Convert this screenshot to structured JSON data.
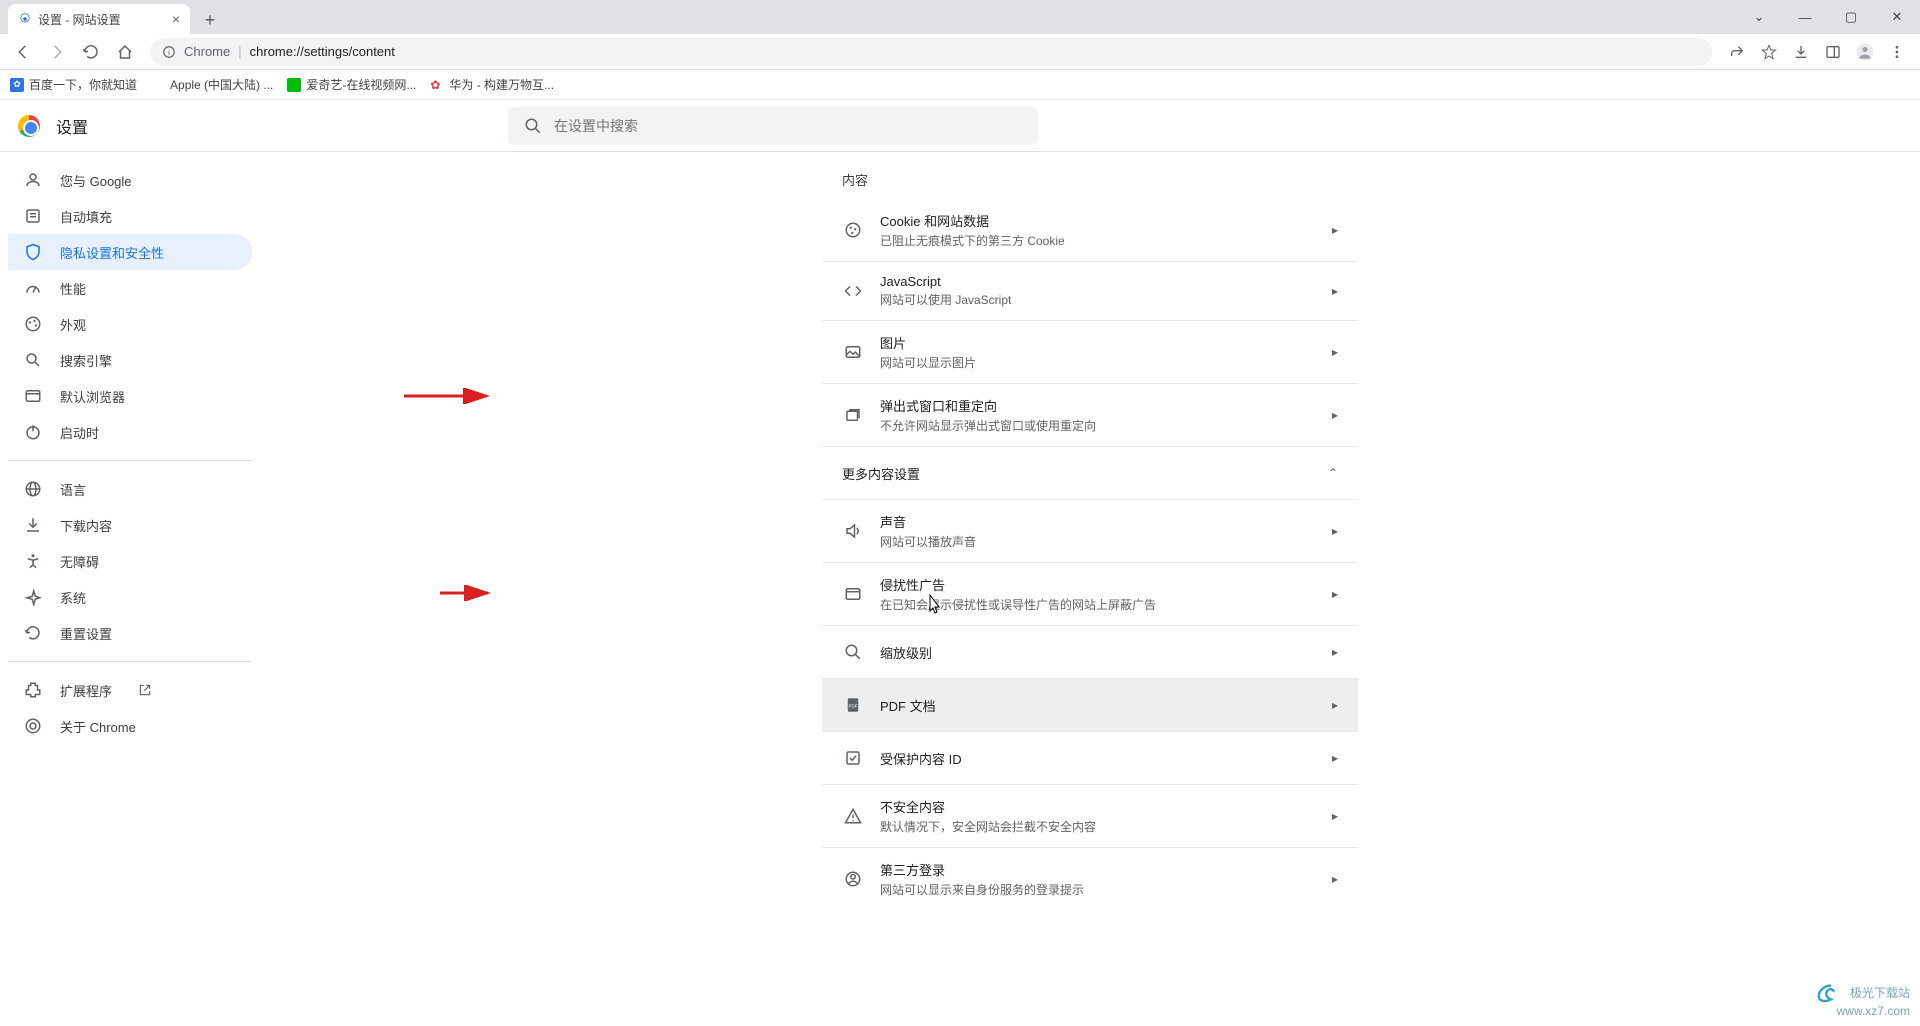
{
  "titlebar": {
    "tab_title": "设置 - 网站设置",
    "tab_close": "×",
    "newtab": "+"
  },
  "toolbar": {
    "chrome_label": "Chrome",
    "url": "chrome://settings/content"
  },
  "bookmarks": {
    "items": [
      {
        "label": "百度一下，你就知道"
      },
      {
        "label": "Apple (中国大陆) ..."
      },
      {
        "label": "爱奇艺-在线视频网..."
      },
      {
        "label": "华为 - 构建万物互..."
      }
    ]
  },
  "settings": {
    "title": "设置",
    "search_placeholder": "在设置中搜索"
  },
  "sidebar": {
    "items": [
      {
        "label": "您与 Google"
      },
      {
        "label": "自动填充"
      },
      {
        "label": "隐私设置和安全性"
      },
      {
        "label": "性能"
      },
      {
        "label": "外观"
      },
      {
        "label": "搜索引擎"
      },
      {
        "label": "默认浏览器"
      },
      {
        "label": "启动时"
      }
    ],
    "items2": [
      {
        "label": "语言"
      },
      {
        "label": "下载内容"
      },
      {
        "label": "无障碍"
      },
      {
        "label": "系统"
      },
      {
        "label": "重置设置"
      }
    ],
    "items3": [
      {
        "label": "扩展程序"
      },
      {
        "label": "关于 Chrome"
      }
    ]
  },
  "content": {
    "section_title": "内容",
    "rows": [
      {
        "title": "Cookie 和网站数据",
        "sub": "已阻止无痕模式下的第三方 Cookie"
      },
      {
        "title": "JavaScript",
        "sub": "网站可以使用 JavaScript"
      },
      {
        "title": "图片",
        "sub": "网站可以显示图片"
      },
      {
        "title": "弹出式窗口和重定向",
        "sub": "不允许网站显示弹出式窗口或使用重定向"
      }
    ],
    "more_settings": "更多内容设置",
    "rows2": [
      {
        "title": "声音",
        "sub": "网站可以播放声音"
      },
      {
        "title": "侵扰性广告",
        "sub": "在已知会展示侵扰性或误导性广告的网站上屏蔽广告"
      },
      {
        "title": "缩放级别",
        "sub": ""
      },
      {
        "title": "PDF 文档",
        "sub": ""
      },
      {
        "title": "受保护内容 ID",
        "sub": ""
      },
      {
        "title": "不安全内容",
        "sub": "默认情况下，安全网站会拦截不安全内容"
      },
      {
        "title": "第三方登录",
        "sub": "网站可以显示来自身份服务的登录提示"
      }
    ]
  },
  "watermark": {
    "line1": "极光下载站",
    "line2": "www.xz7.com"
  }
}
